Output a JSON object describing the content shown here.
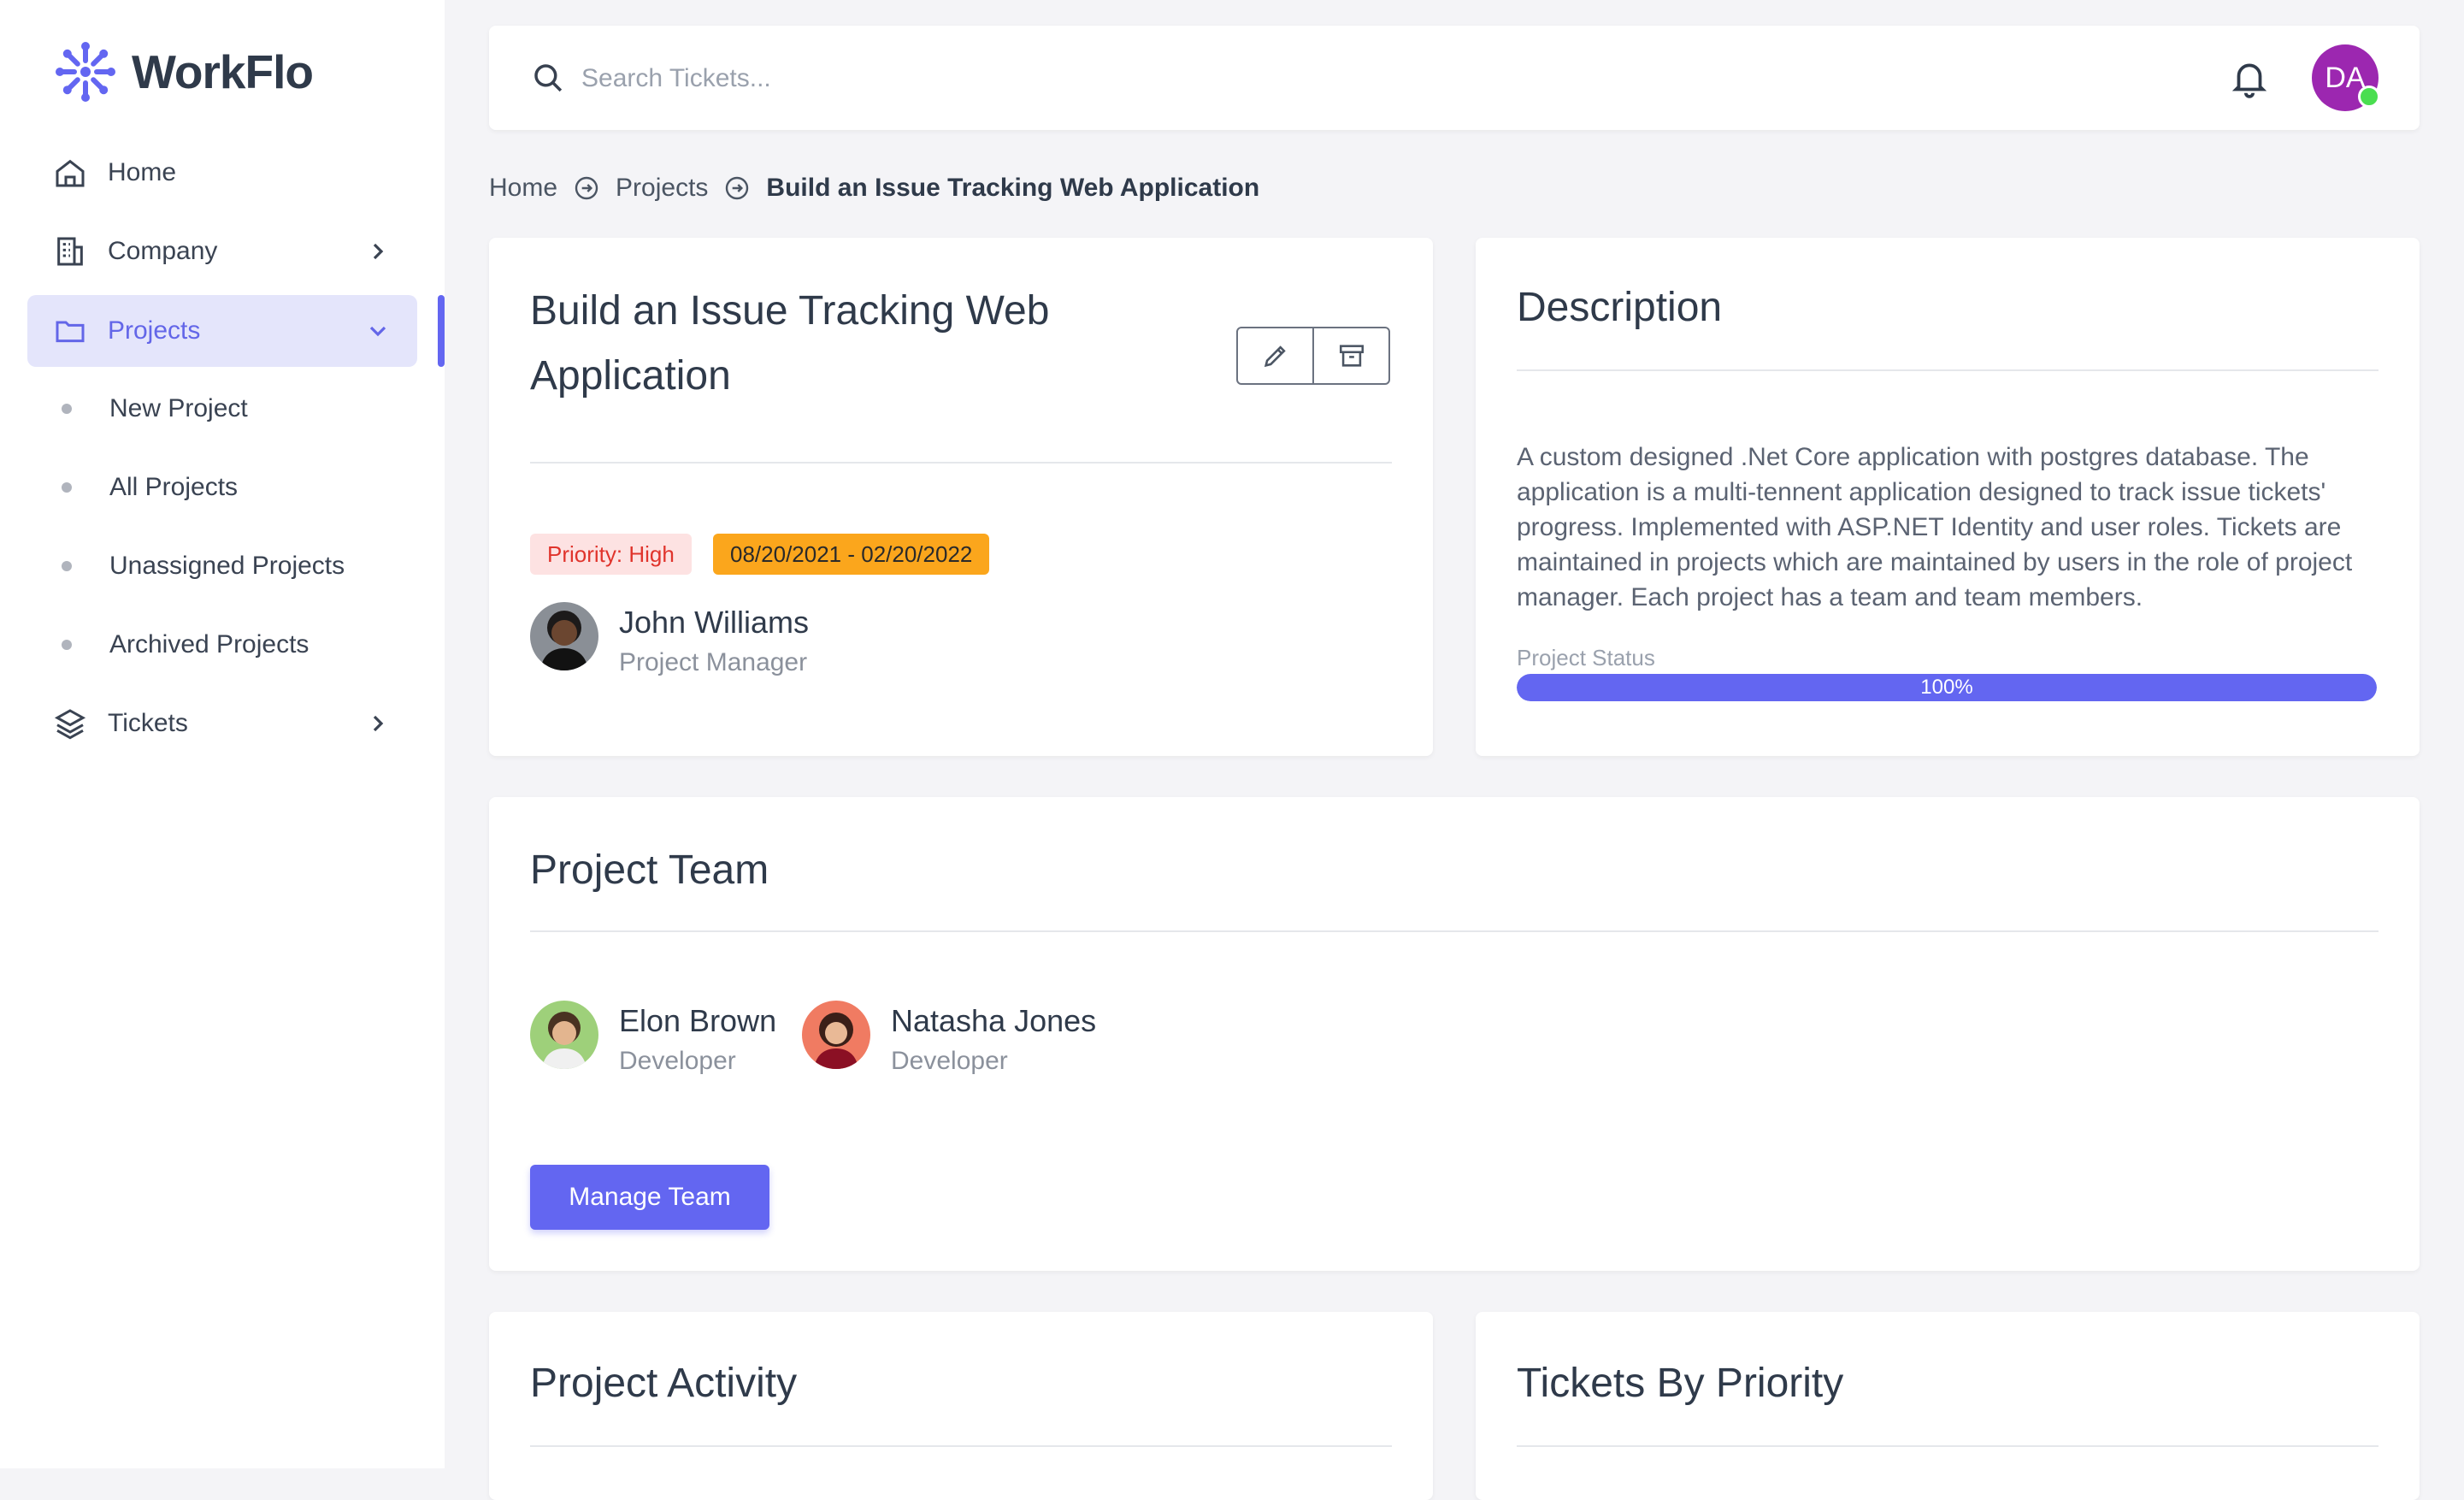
{
  "app": {
    "name": "WorkFlo"
  },
  "sidebar": {
    "items": [
      {
        "label": "Home",
        "icon": "home-icon"
      },
      {
        "label": "Company",
        "icon": "building-icon"
      },
      {
        "label": "Projects",
        "icon": "folder-icon"
      },
      {
        "label": "Tickets",
        "icon": "layers-icon"
      }
    ],
    "projects_sub": [
      {
        "label": "New Project"
      },
      {
        "label": "All Projects"
      },
      {
        "label": "Unassigned Projects"
      },
      {
        "label": "Archived Projects"
      }
    ]
  },
  "header": {
    "search_placeholder": "Search Tickets...",
    "user_initials": "DA",
    "user_avatar_color": "#9c27b0"
  },
  "breadcrumb": {
    "items": [
      "Home",
      "Projects"
    ],
    "current": "Build an Issue Tracking Web Application"
  },
  "project": {
    "title": "Build an Issue Tracking Web Application",
    "priority": "Priority: High",
    "dates": "08/20/2021 - 02/20/2022",
    "manager": {
      "name": "John Williams",
      "role": "Project Manager"
    }
  },
  "description": {
    "title": "Description",
    "text": "A custom designed .Net Core application with postgres database. The application is a multi-tennent application designed to track issue tickets' progress. Implemented with ASP.NET Identity and user roles. Tickets are maintained in projects which are maintained by users in the role of project manager. Each project has a team and team members.",
    "status_label": "Project Status",
    "progress_text": "100%",
    "progress_value": 1.0
  },
  "team": {
    "title": "Project Team",
    "members": [
      {
        "name": "Elon Brown",
        "role": "Developer"
      },
      {
        "name": "Natasha Jones",
        "role": "Developer"
      }
    ],
    "manage_label": "Manage Team"
  },
  "activity": {
    "title": "Project Activity"
  },
  "tickets_priority": {
    "title": "Tickets By Priority"
  },
  "colors": {
    "accent": "#6366f1",
    "priority_bg": "#fde2e2",
    "priority_text": "#e0342c",
    "date_bg": "#fba61c"
  }
}
